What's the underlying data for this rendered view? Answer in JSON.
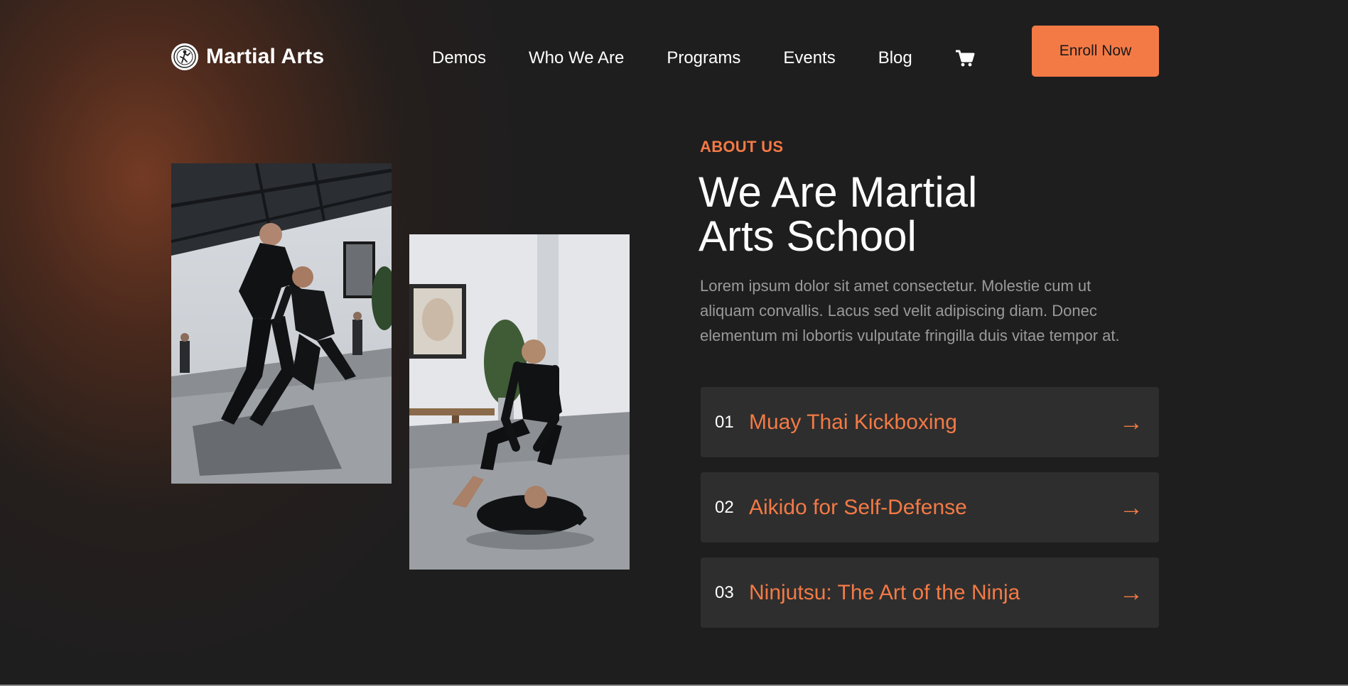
{
  "brand": {
    "name": "Martial Arts",
    "accent_color": "#f47a45"
  },
  "nav": {
    "items": [
      {
        "label": "Demos"
      },
      {
        "label": "Who We Are"
      },
      {
        "label": "Programs"
      },
      {
        "label": "Events"
      },
      {
        "label": "Blog"
      }
    ],
    "cart_icon": "cart-icon",
    "cta_label": "Enroll Now"
  },
  "about": {
    "eyebrow": "ABOUT US",
    "heading_line1": "We Are Martial",
    "heading_line2": "Arts School",
    "description": "Lorem ipsum dolor sit amet consectetur. Molestie cum ut aliquam convallis. Lacus sed velit adipiscing diam. Donec elementum mi lobortis vulputate fringilla duis vitae tempor at."
  },
  "programs": [
    {
      "number": "01",
      "title": "Muay Thai Kickboxing",
      "arrow": "→"
    },
    {
      "number": "02",
      "title": "Aikido for Self-Defense",
      "arrow": "→"
    },
    {
      "number": "03",
      "title": "Ninjutsu: The Art of the Ninja",
      "arrow": "→"
    }
  ]
}
